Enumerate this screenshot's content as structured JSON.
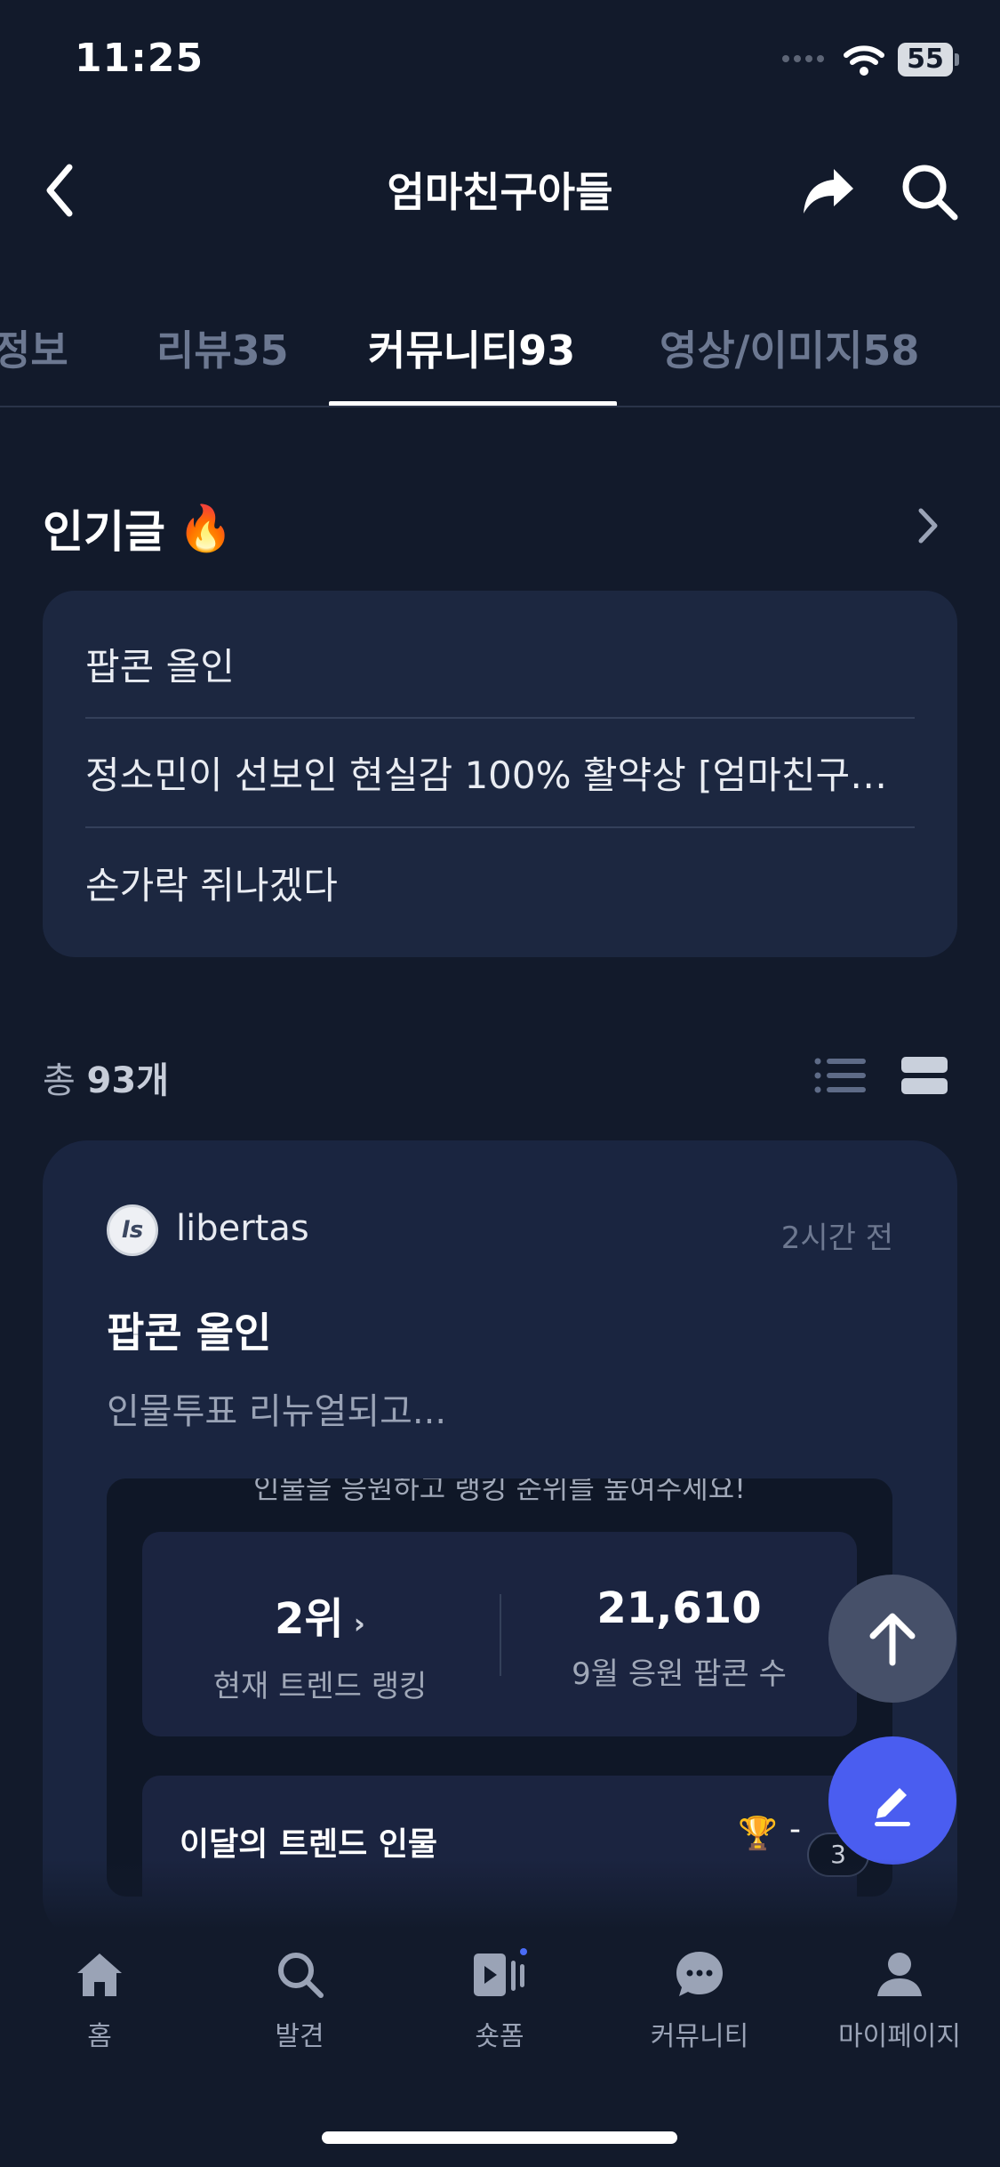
{
  "status_bar": {
    "time": "11:25",
    "battery": "55"
  },
  "nav": {
    "title": "엄마친구아들"
  },
  "tabs": [
    {
      "label": "정보"
    },
    {
      "label": "리뷰35"
    },
    {
      "label": "커뮤니티93"
    },
    {
      "label": "영상/이미지58"
    }
  ],
  "popular": {
    "title": "인기글",
    "emoji": "🔥",
    "items": [
      "팝콘 올인",
      "정소민이 선보인 현실감 100% 활약상 [엄마친구…",
      "손가락 쥐나겠다"
    ]
  },
  "total": {
    "prefix": "총",
    "count": "93개"
  },
  "post": {
    "avatar_letter": "ls",
    "author": "libertas",
    "time": "2시간 전",
    "title": "팝콘 올인",
    "excerpt": "인물투표 리뉴얼되고...",
    "embed": {
      "caption": "인물을 응원하고 랭킹 순위를 높여주세요!",
      "rank_value": "2위",
      "rank_label": "현재 트렌드 랭킹",
      "popcorn_value": "21,610",
      "popcorn_label": "9월 응원 팝콘 수",
      "trend_title": "이달의 트렌드 인물",
      "trend_dash": "-",
      "trend_count": "3"
    }
  },
  "bottom_nav": [
    {
      "label": "홈",
      "icon": "home-icon"
    },
    {
      "label": "발견",
      "icon": "search-icon"
    },
    {
      "label": "숏폼",
      "icon": "shortform-icon"
    },
    {
      "label": "커뮤니티",
      "icon": "chat-icon"
    },
    {
      "label": "마이페이지",
      "icon": "person-icon"
    }
  ],
  "colors": {
    "background": "#121a2b",
    "card": "#1c2740",
    "accent": "#4a5df0",
    "muted": "#6c7891"
  }
}
